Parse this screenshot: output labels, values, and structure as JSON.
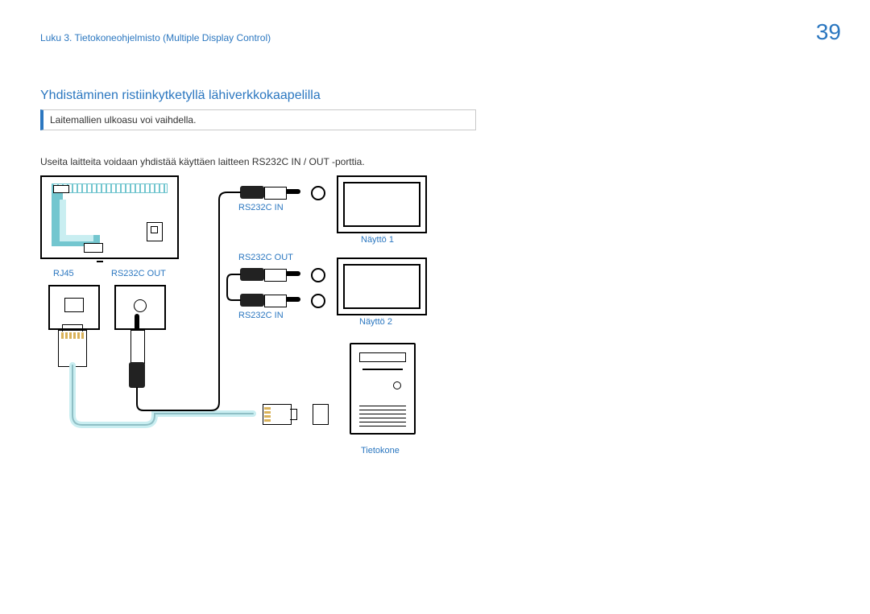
{
  "header": {
    "chapter": "Luku 3. Tietokoneohjelmisto (Multiple Display Control)",
    "page_number": "39"
  },
  "section": {
    "title": "Yhdistäminen ristiinkytketyllä lähiverkkokaapelilla",
    "note": "Laitemallien ulkoasu voi vaihdella.",
    "body": "Useita laitteita voidaan yhdistää käyttäen laitteen RS232C IN / OUT -porttia."
  },
  "labels": {
    "rj45": "RJ45",
    "rs232c_out": "RS232C OUT",
    "rs232c_in": "RS232C IN",
    "monitor1": "Näyttö 1",
    "monitor2": "Näyttö 2",
    "computer": "Tietokone"
  }
}
